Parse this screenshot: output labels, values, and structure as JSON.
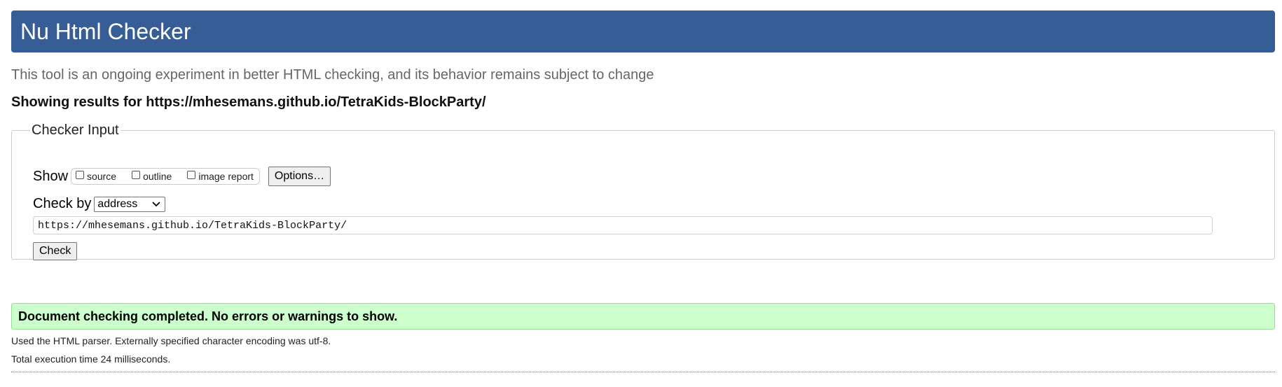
{
  "header": {
    "title": "Nu Html Checker"
  },
  "subtitle": "This tool is an ongoing experiment in better HTML checking, and its behavior remains subject to change",
  "results_for": "Showing results for https://mhesemans.github.io/TetraKids-BlockParty/",
  "checker_input": {
    "legend": "Checker Input",
    "show_label": "Show",
    "show_options": [
      {
        "label": "source",
        "checked": false
      },
      {
        "label": "outline",
        "checked": false
      },
      {
        "label": "image report",
        "checked": false
      }
    ],
    "options_button": "Options…",
    "check_by_label": "Check by",
    "check_by_selected": "address",
    "url_value": "https://mhesemans.github.io/TetraKids-BlockParty/",
    "check_button": "Check"
  },
  "result": {
    "message": "Document checking completed. No errors or warnings to show.",
    "parser_info": "Used the HTML parser. Externally specified character encoding was utf-8.",
    "execution_time": "Total execution time 24 milliseconds."
  },
  "colors": {
    "header_bg": "#365d95",
    "success_bg": "#ccffcc",
    "subtitle_text": "#666666"
  },
  "icons": {
    "select_chevron": "chevron-down-icon"
  }
}
